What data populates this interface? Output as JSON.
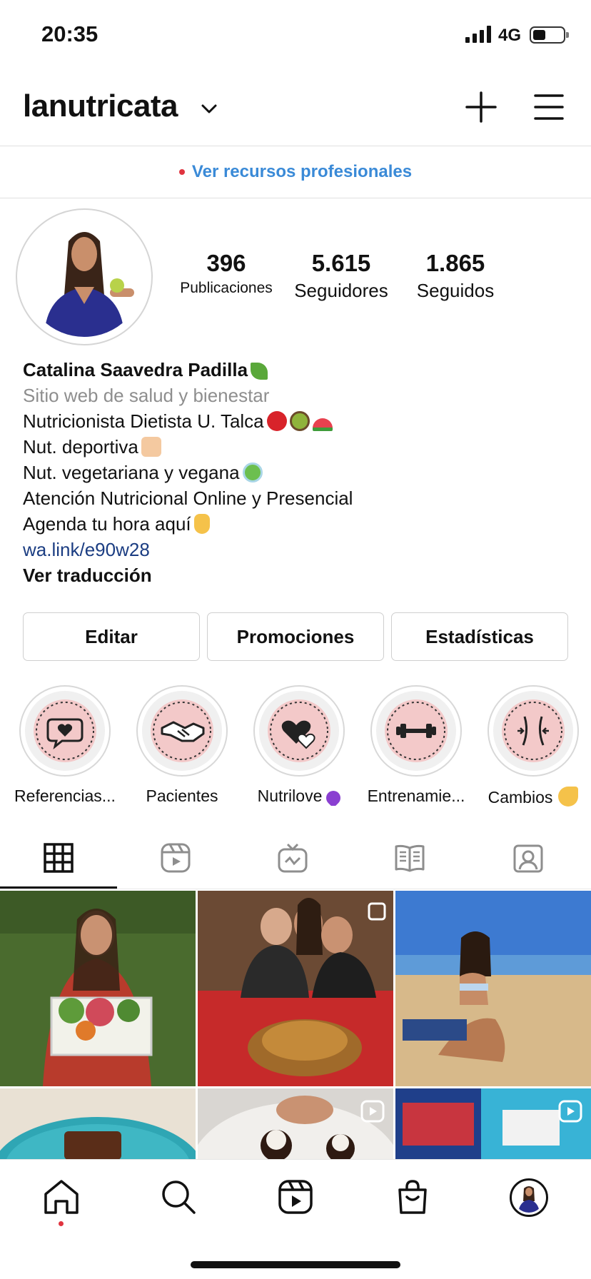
{
  "status_bar": {
    "time": "20:35",
    "network": "4G"
  },
  "header": {
    "username": "lanutricata"
  },
  "pro_banner": {
    "label": "Ver recursos profesionales"
  },
  "stats": [
    {
      "value": "396",
      "label": "Publicaciones"
    },
    {
      "value": "5.615",
      "label": "Seguidores"
    },
    {
      "value": "1.865",
      "label": "Seguidos"
    }
  ],
  "bio": {
    "name": "Catalina Saavedra Padilla",
    "category": "Sitio web de salud y bienestar",
    "lines": [
      "Nutricionista Dietista U. Talca",
      "Nut. deportiva",
      "Nut. vegetariana y vegana",
      "Atención Nutricional Online y Presencial",
      "Agenda tu hora aquí"
    ],
    "link": "wa.link/e90w28",
    "translate": "Ver traducción"
  },
  "buttons": {
    "edit": "Editar",
    "promotions": "Promociones",
    "insights": "Estadísticas"
  },
  "highlights": [
    {
      "label": "Referencias...",
      "icon": "speech-heart-icon"
    },
    {
      "label": "Pacientes",
      "icon": "handshake-icon"
    },
    {
      "label": "Nutrilove",
      "icon": "hearts-icon"
    },
    {
      "label": "Entrenamie...",
      "icon": "dumbbell-icon"
    },
    {
      "label": "Cambios",
      "icon": "waist-icon"
    }
  ],
  "colors": {
    "link_blue": "#3a8ad7",
    "bio_link": "#1b3d82",
    "highlight_bg": "#f3c9c9",
    "notif_red": "#e0343f"
  }
}
